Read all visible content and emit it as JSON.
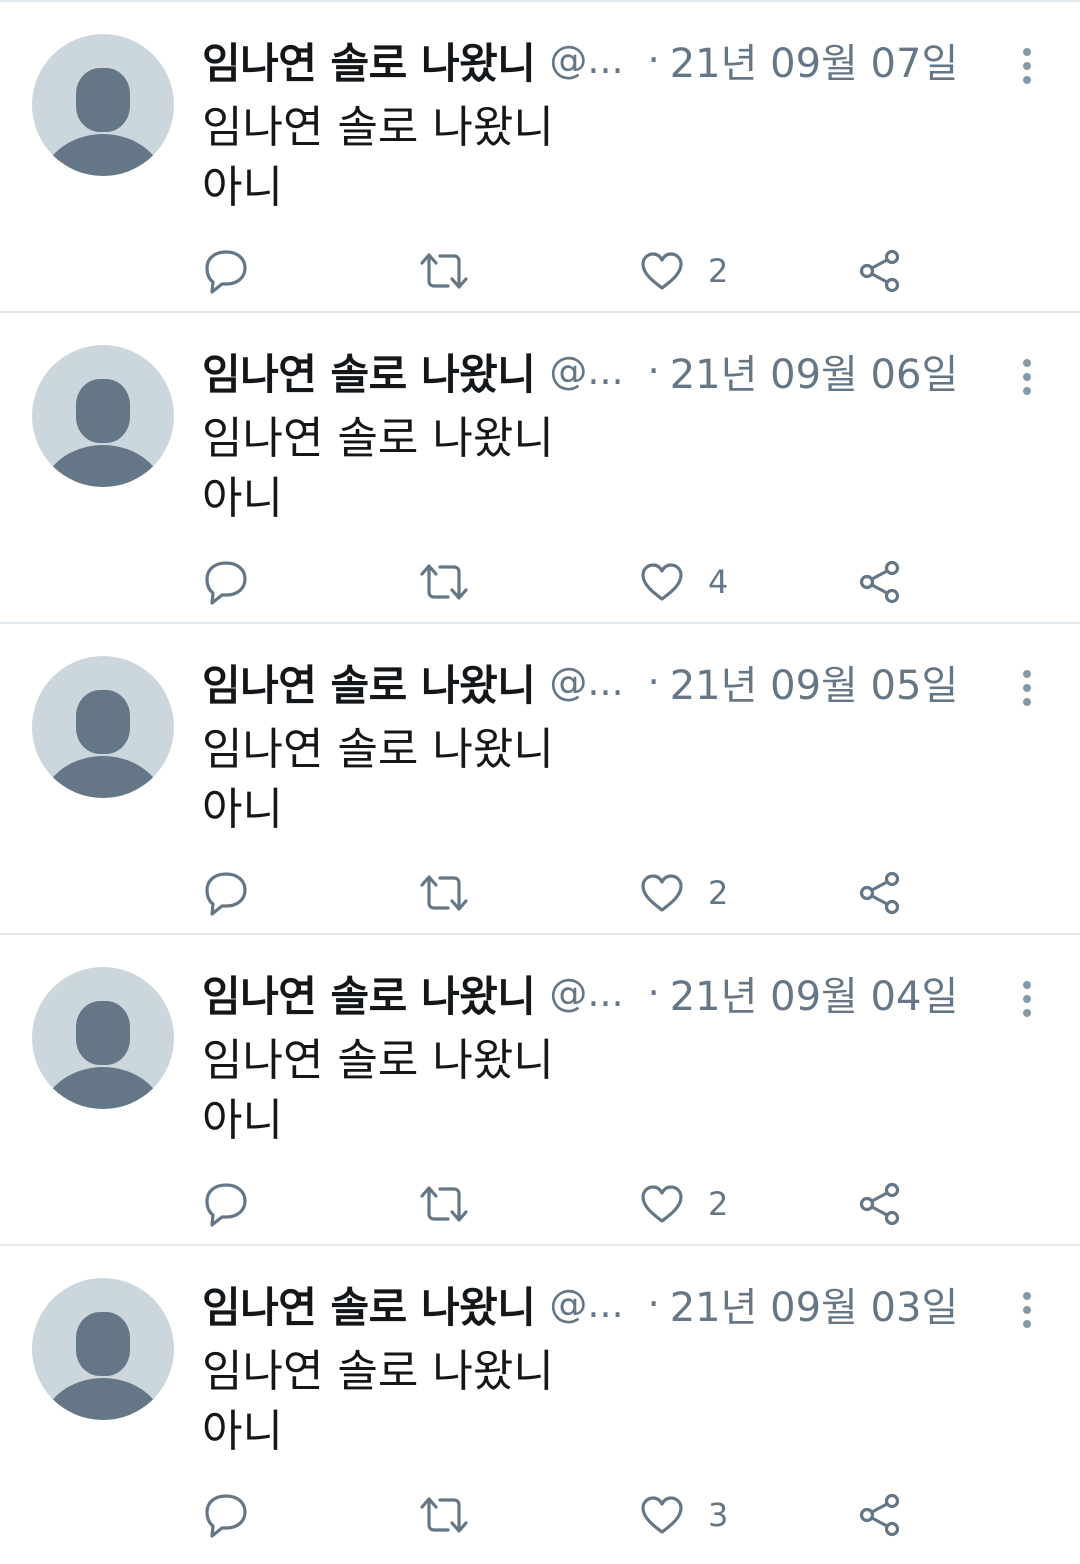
{
  "colors": {
    "text_primary": "#14171a",
    "text_secondary": "#657786",
    "divider": "#e1e8ed",
    "avatar_bg": "#ccd6dd",
    "avatar_figure": "#657786"
  },
  "icons": {
    "reply": "reply-icon",
    "retweet": "retweet-icon",
    "like": "heart-icon",
    "share": "share-icon",
    "more": "more-vertical-icon",
    "avatar": "default-avatar-icon"
  },
  "tweets": [
    {
      "display_name": "임나연 솔로 나왔니",
      "handle": "@...",
      "separator": "·",
      "date": "21년 09월 07일",
      "text_line1": "임나연 솔로 나왔니",
      "text_line2": "아니",
      "like_count": "2"
    },
    {
      "display_name": "임나연 솔로 나왔니",
      "handle": "@...",
      "separator": "·",
      "date": "21년 09월 06일",
      "text_line1": "임나연 솔로 나왔니",
      "text_line2": "아니",
      "like_count": "4"
    },
    {
      "display_name": "임나연 솔로 나왔니",
      "handle": "@...",
      "separator": "·",
      "date": "21년 09월 05일",
      "text_line1": "임나연 솔로 나왔니",
      "text_line2": "아니",
      "like_count": "2"
    },
    {
      "display_name": "임나연 솔로 나왔니",
      "handle": "@...",
      "separator": "·",
      "date": "21년 09월 04일",
      "text_line1": "임나연 솔로 나왔니",
      "text_line2": "아니",
      "like_count": "2"
    },
    {
      "display_name": "임나연 솔로 나왔니",
      "handle": "@...",
      "separator": "·",
      "date": "21년 09월 03일",
      "text_line1": "임나연 솔로 나왔니",
      "text_line2": "아니",
      "like_count": "3"
    }
  ]
}
